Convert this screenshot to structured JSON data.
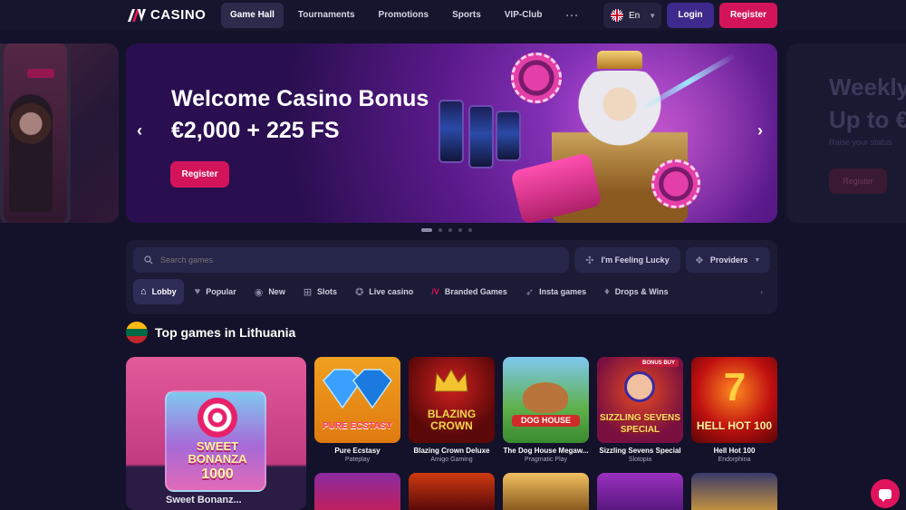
{
  "header": {
    "logo_text": "CASINO",
    "nav": [
      "Game Hall",
      "Tournaments",
      "Promotions",
      "Sports",
      "VIP-Club"
    ],
    "more": "···",
    "language": "En",
    "login": "Login",
    "register": "Register"
  },
  "banner": {
    "title_line1": "Welcome Casino Bonus",
    "title_line2": "€2,000 + 225 FS",
    "button": "Register",
    "prev": "‹",
    "next": "›"
  },
  "side_banner_right": {
    "line1": "Weekly",
    "line2": "Up to €",
    "subtitle": "Raise your status",
    "button": "Register"
  },
  "search": {
    "placeholder": "Search games",
    "lucky": "I'm Feeling Lucky",
    "providers": "Providers"
  },
  "categories": [
    "Lobby",
    "Popular",
    "New",
    "Slots",
    "Live casino",
    "Branded Games",
    "Insta games",
    "Drops & Wins"
  ],
  "section": {
    "title": "Top games in Lithuania"
  },
  "featured": {
    "art_line1": "SWEET",
    "art_line2": "BONANZA",
    "art_line3": "1000",
    "name": "Sweet Bonanz..."
  },
  "games": [
    {
      "name": "Pure Ecstasy",
      "provider": "Pateplay",
      "art": "PURE ECSTASY"
    },
    {
      "name": "Blazing Crown Deluxe",
      "provider": "Amigo Gaming",
      "art": "BLAZING CROWN"
    },
    {
      "name": "The Dog House Megaw...",
      "provider": "Pragmatic Play",
      "art": "DOG HOUSE"
    },
    {
      "name": "Sizzling Sevens Special",
      "provider": "Slotopia",
      "art": "SIZZLING SEVENS SPECIAL",
      "tag": "BONUS BUY"
    },
    {
      "name": "Hell Hot 100",
      "provider": "Endorphina",
      "art": "HELL HOT 100"
    }
  ],
  "colors": {
    "background": "#13122a",
    "accent_pink": "#d4145a",
    "accent_purple": "#3e2a8c"
  }
}
